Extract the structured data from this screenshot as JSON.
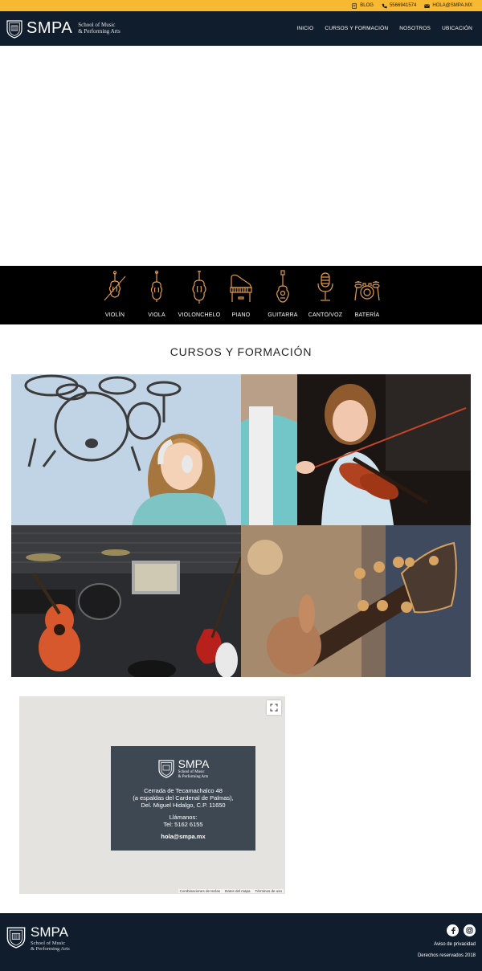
{
  "topbar": {
    "blog_label": "BLOG",
    "phone": "5566941574",
    "email": "HOLA@SMPA.MX"
  },
  "nav": {
    "brand_name": "SMPA",
    "brand_line1": "School of Music",
    "brand_line2": "& Performing Arts",
    "menu": [
      "INICIO",
      "CURSOS Y FORMACIÓN",
      "NOSOTROS",
      "UBICACIÓN"
    ]
  },
  "instruments": [
    {
      "label": "VIOLÍN",
      "icon": "violin-icon"
    },
    {
      "label": "VIOLA",
      "icon": "viola-icon"
    },
    {
      "label": "VIOLONCHELO",
      "icon": "cello-icon"
    },
    {
      "label": "PIANO",
      "icon": "piano-icon"
    },
    {
      "label": "GUITARRA",
      "icon": "guitar-icon"
    },
    {
      "label": "CANTO/VOZ",
      "icon": "microphone-icon"
    },
    {
      "label": "BATERÍA",
      "icon": "drums-icon"
    }
  ],
  "courses": {
    "title": "CURSOS Y FORMACIÓN"
  },
  "map": {
    "card_brand": "SMPA",
    "card_sub1": "School of Music",
    "card_sub2": "& Performing Arts",
    "address_line1": "Cerrada de Tecamachalco 48",
    "address_line2": "(a espaldas del Cardenal de Palmas),",
    "address_line3": "Del. Miguel Hidalgo, C.P. 11650",
    "call_label": "Llámanos:",
    "call_number": "Tel: 5162 6155",
    "email": "hola@smpa.mx",
    "attrib_shortcuts": "Combinaciones de teclas",
    "attrib_data": "Datos del mapa",
    "attrib_terms": "Términos de uso"
  },
  "footer": {
    "brand_name": "SMPA",
    "brand_line1": "School of Music",
    "brand_line2": "& Performing Arts",
    "privacy": "Aviso de privacidad",
    "rights": "Derechos reservados 2018"
  },
  "colors": {
    "accent": "#f8b932",
    "navy": "#0f1d2c",
    "icon_orange": "#e39a4e",
    "map_card": "#3d4852"
  }
}
